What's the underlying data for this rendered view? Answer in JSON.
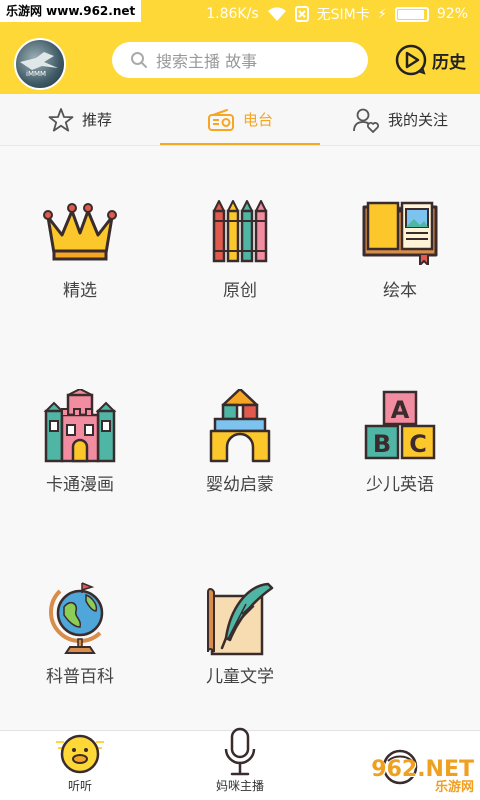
{
  "watermark": {
    "top_text": "乐游网 www.962.net",
    "bottom_brand": "962.NET",
    "bottom_sub": "乐游网"
  },
  "status_bar": {
    "speed": "1.86K/s",
    "sim": "无SIM卡",
    "battery": "92%",
    "battery_level": 0.92
  },
  "header": {
    "search_placeholder": "搜索主播 故事",
    "history_label": "历史",
    "avatar_caption": "iMMM"
  },
  "tabs": [
    {
      "label": "推荐",
      "icon": "star-icon",
      "active": false
    },
    {
      "label": "电台",
      "icon": "radio-icon",
      "active": true
    },
    {
      "label": "我的关注",
      "icon": "user-heart-icon",
      "active": false
    }
  ],
  "categories": [
    {
      "label": "精选",
      "icon": "crown-icon"
    },
    {
      "label": "原创",
      "icon": "crayons-icon"
    },
    {
      "label": "绘本",
      "icon": "picture-book-icon"
    },
    {
      "label": "卡通漫画",
      "icon": "castle-icon"
    },
    {
      "label": "婴幼启蒙",
      "icon": "building-blocks-icon"
    },
    {
      "label": "少儿英语",
      "icon": "abc-blocks-icon"
    },
    {
      "label": "科普百科",
      "icon": "globe-icon"
    },
    {
      "label": "儿童文学",
      "icon": "quill-book-icon"
    }
  ],
  "bottom_nav": [
    {
      "label": "听听",
      "icon": "duck-icon"
    },
    {
      "label": "妈咪主播",
      "icon": "microphone-icon"
    },
    {
      "label": "",
      "icon": "profile-icon"
    }
  ]
}
